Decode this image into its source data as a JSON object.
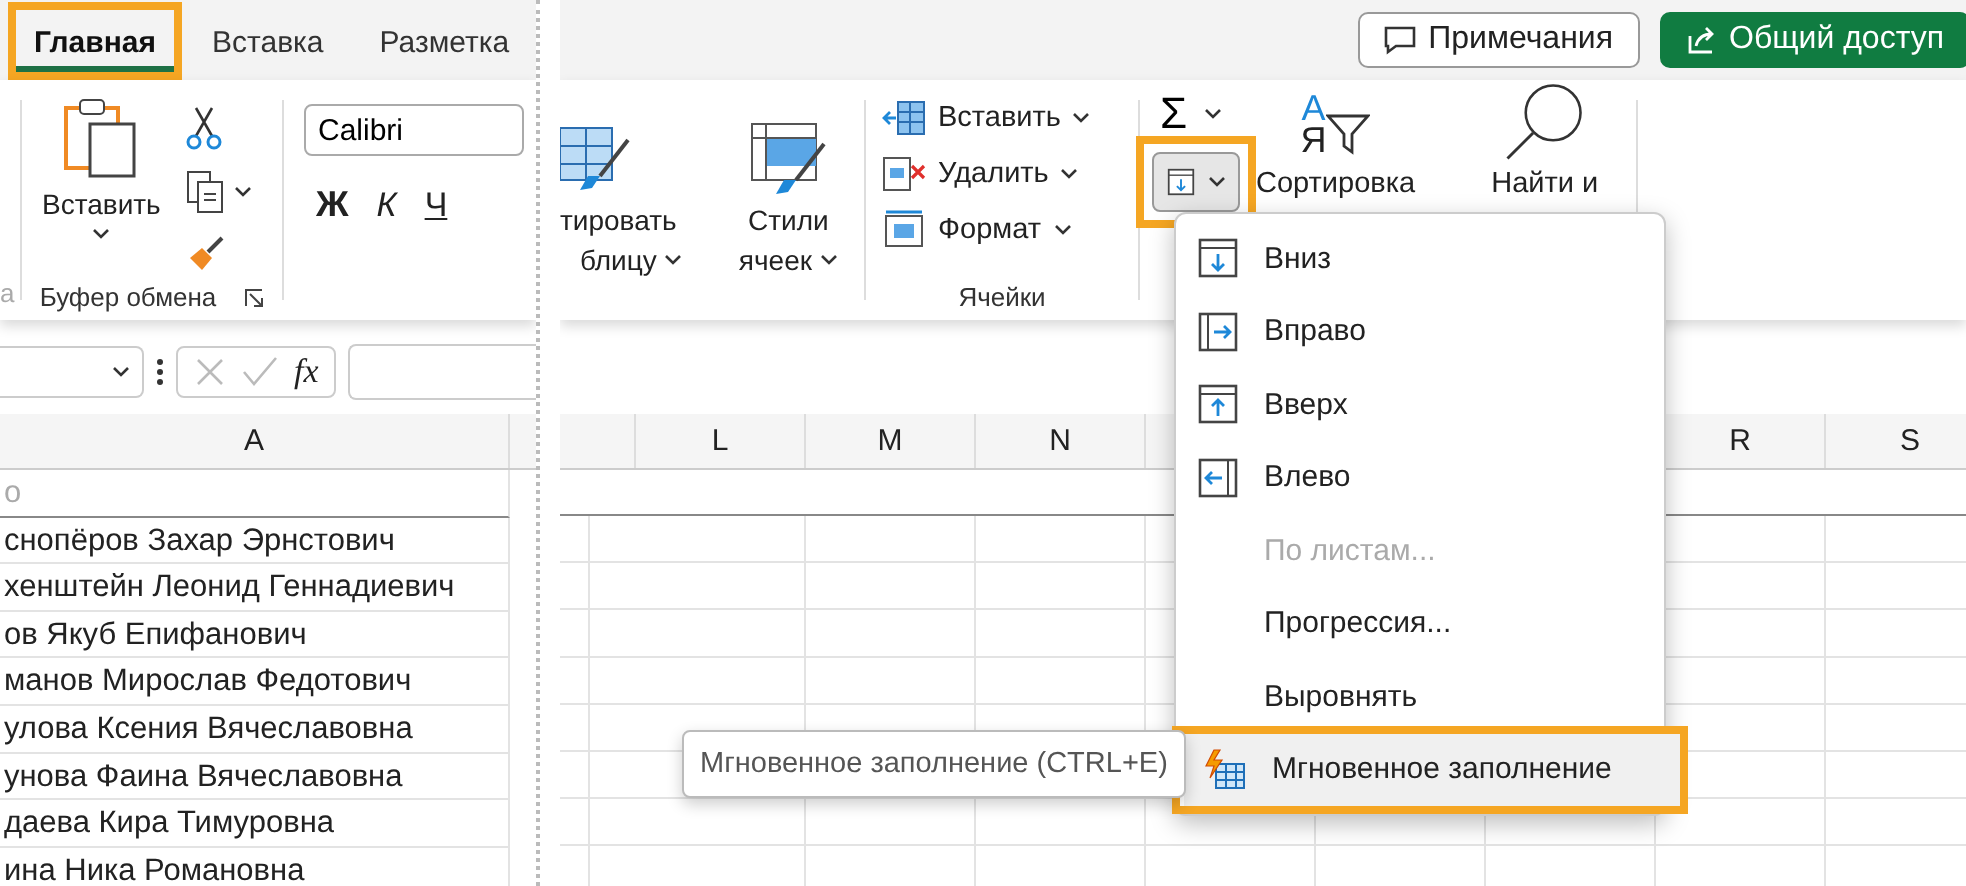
{
  "left_panel": {
    "tabs": [
      {
        "label": "Главная",
        "selected": true,
        "highlighted": true
      },
      {
        "label": "Вставка",
        "selected": false,
        "highlighted": false
      },
      {
        "label": "Разметка",
        "selected": false,
        "highlighted": false
      }
    ],
    "prev_group_label": "а",
    "clipboard": {
      "paste_label": "Вставить",
      "group_label": "Буфер обмена"
    },
    "font": {
      "name": "Calibri",
      "style_buttons": [
        "Ж",
        "К",
        "Ч"
      ]
    },
    "formula_bar": {
      "fx": "fx"
    },
    "column": "A",
    "rows": [
      "о",
      "снопёров Захар Эрнстович",
      "хенштейн Леонид Геннадиевич",
      "ов Якуб Епифанович",
      "манов Мирослав Федотович",
      "улова Ксения Вячеславовна",
      "унова Фаина Вячеславовна",
      "даева Кира Тимуровна",
      "ина Ника Романовна"
    ]
  },
  "right_panel": {
    "buttons": [
      {
        "label": "Примечания",
        "kind": "outline"
      },
      {
        "label": "Общий доступ",
        "kind": "primary"
      }
    ],
    "styles_group": {
      "format_table": [
        "тировать",
        "блицу"
      ],
      "cell_styles": [
        "Стили",
        "ячеек"
      ]
    },
    "cells_group": {
      "items": [
        {
          "label": "Вставить",
          "kind": "insert"
        },
        {
          "label": "Удалить",
          "kind": "delete"
        },
        {
          "label": "Формат",
          "kind": "format"
        }
      ],
      "label": "Ячейки"
    },
    "editing_group": {
      "sum": "Σ",
      "fill_highlighted": true,
      "sort_letters": [
        "А",
        "Я"
      ],
      "sort_label": "Сортировка",
      "find_label": "Найти и"
    },
    "columns_left": [
      "L",
      "M",
      "N"
    ],
    "columns_right": [
      "R",
      "S"
    ]
  },
  "fill_menu": {
    "items": [
      {
        "label": "Вниз",
        "kind": "down",
        "disabled": false,
        "selected": false
      },
      {
        "label": "Вправо",
        "kind": "right",
        "disabled": false,
        "selected": false
      },
      {
        "label": "Вверх",
        "kind": "up",
        "disabled": false,
        "selected": false
      },
      {
        "label": "Влево",
        "kind": "left",
        "disabled": false,
        "selected": false
      },
      {
        "label": "По листам...",
        "kind": "text",
        "disabled": true,
        "selected": false
      },
      {
        "label": "Прогрессия...",
        "kind": "text",
        "disabled": false,
        "selected": false
      },
      {
        "label": "Выровнять",
        "kind": "text",
        "disabled": false,
        "selected": false
      },
      {
        "label": "Мгновенное заполнение",
        "kind": "flash",
        "disabled": false,
        "selected": true,
        "highlighted": true
      }
    ]
  },
  "tooltip": "Мгновенное заполнение (CTRL+E)"
}
